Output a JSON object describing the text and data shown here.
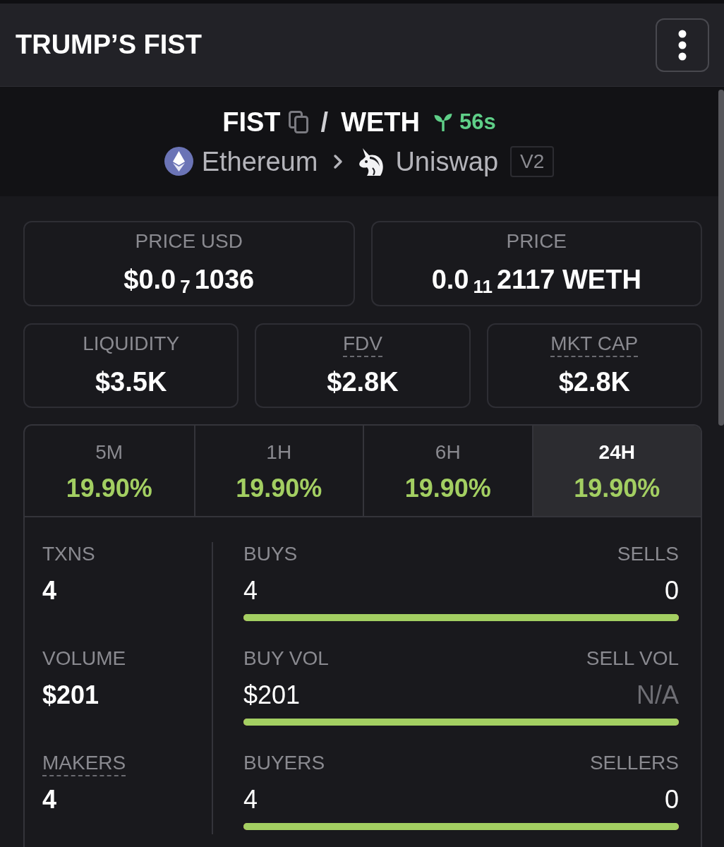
{
  "header": {
    "title": "TRUMP’S FIST"
  },
  "pair": {
    "base": "FIST",
    "separator": "/",
    "quote": "WETH",
    "age": "56s",
    "chain": "Ethereum",
    "dex": "Uniswap",
    "version": "V2"
  },
  "price_cards": [
    {
      "label": "PRICE USD",
      "value": "$0.0$_{7}$1036"
    },
    {
      "label": "PRICE",
      "value": "0.0$_{11}$2117 WETH"
    }
  ],
  "stats": [
    {
      "label": "LIQUIDITY",
      "value": "$3.5K",
      "underlined": false
    },
    {
      "label": "FDV",
      "value": "$2.8K",
      "underlined": true
    },
    {
      "label": "MKT CAP",
      "value": "$2.8K",
      "underlined": true
    }
  ],
  "timeframes": [
    {
      "label": "5M",
      "change": "19.90%",
      "selected": false
    },
    {
      "label": "1H",
      "change": "19.90%",
      "selected": false
    },
    {
      "label": "6H",
      "change": "19.90%",
      "selected": false
    },
    {
      "label": "24H",
      "change": "19.90%",
      "selected": true
    }
  ],
  "summary": [
    {
      "label": "TXNS",
      "value": "4",
      "underlined": false
    },
    {
      "label": "VOLUME",
      "value": "$201",
      "underlined": false
    },
    {
      "label": "MAKERS",
      "value": "4",
      "underlined": true
    }
  ],
  "splits": [
    {
      "left": {
        "label": "BUYS",
        "value": "4"
      },
      "right": {
        "label": "SELLS",
        "value": "0",
        "muted": false
      },
      "level": 1
    },
    {
      "left": {
        "label": "BUY VOL",
        "value": "$201"
      },
      "right": {
        "label": "SELL VOL",
        "value": "N/A",
        "muted": true
      },
      "level": 1
    },
    {
      "left": {
        "label": "BUYERS",
        "value": "4"
      },
      "right": {
        "label": "SELLERS",
        "value": "0",
        "muted": false
      },
      "level": 1
    }
  ]
}
